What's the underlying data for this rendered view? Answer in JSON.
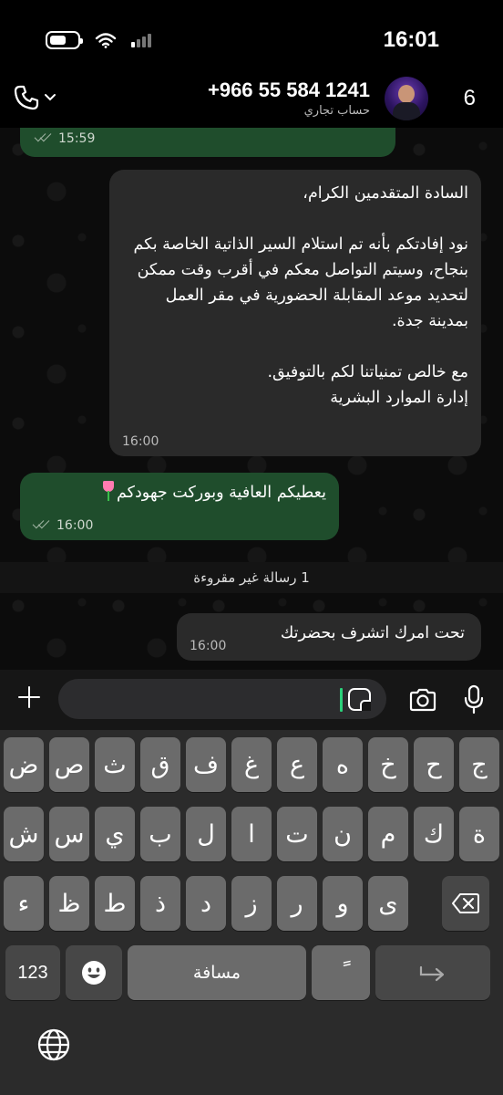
{
  "status_bar": {
    "time": "16:01"
  },
  "header": {
    "contact_number": "+966 55 584 1241",
    "contact_subtitle": "حساب تجاري",
    "back_count": "6"
  },
  "messages": [
    {
      "direction": "out",
      "text": "",
      "time": "15:59",
      "status": "read"
    },
    {
      "direction": "in",
      "text": "السادة المتقدمين الكرام،\n\nنود إفادتكم بأنه تم استلام السير الذاتية الخاصة بكم بنجاح، وسيتم التواصل معكم في أقرب وقت ممكن لتحديد موعد المقابلة الحضورية في مقر العمل بمدينة جدة.\n\nمع خالص تمنياتنا لكم بالتوفيق.\nإدارة الموارد البشرية",
      "time": "16:00"
    },
    {
      "direction": "out",
      "text": "يعطيكم العافية وبوركت جهودكم",
      "emoji": "tulip",
      "time": "16:00",
      "status": "read"
    },
    {
      "direction": "in",
      "text": "تحت امرك اتشرف بحضرتك",
      "time": "16:00"
    }
  ],
  "unread_banner": "1 رسالة غير مقروءة",
  "composer": {
    "placeholder": ""
  },
  "keyboard": {
    "row1": [
      "ض",
      "ص",
      "ث",
      "ق",
      "ف",
      "غ",
      "ع",
      "ه",
      "خ",
      "ح",
      "ج"
    ],
    "row2": [
      "ش",
      "س",
      "ي",
      "ب",
      "ل",
      "ا",
      "ت",
      "ن",
      "م",
      "ك",
      "ة"
    ],
    "row3": [
      "ء",
      "ظ",
      "ط",
      "ذ",
      "د",
      "ز",
      "ر",
      "و",
      "ى"
    ],
    "numbers_key": "123",
    "space_key": "مسافة",
    "tanwin_key": "ً"
  },
  "colors": {
    "outgoing_bubble": "#1f4d2c",
    "incoming_bubble": "#2a2a2a",
    "cursor": "#2bd17a"
  }
}
